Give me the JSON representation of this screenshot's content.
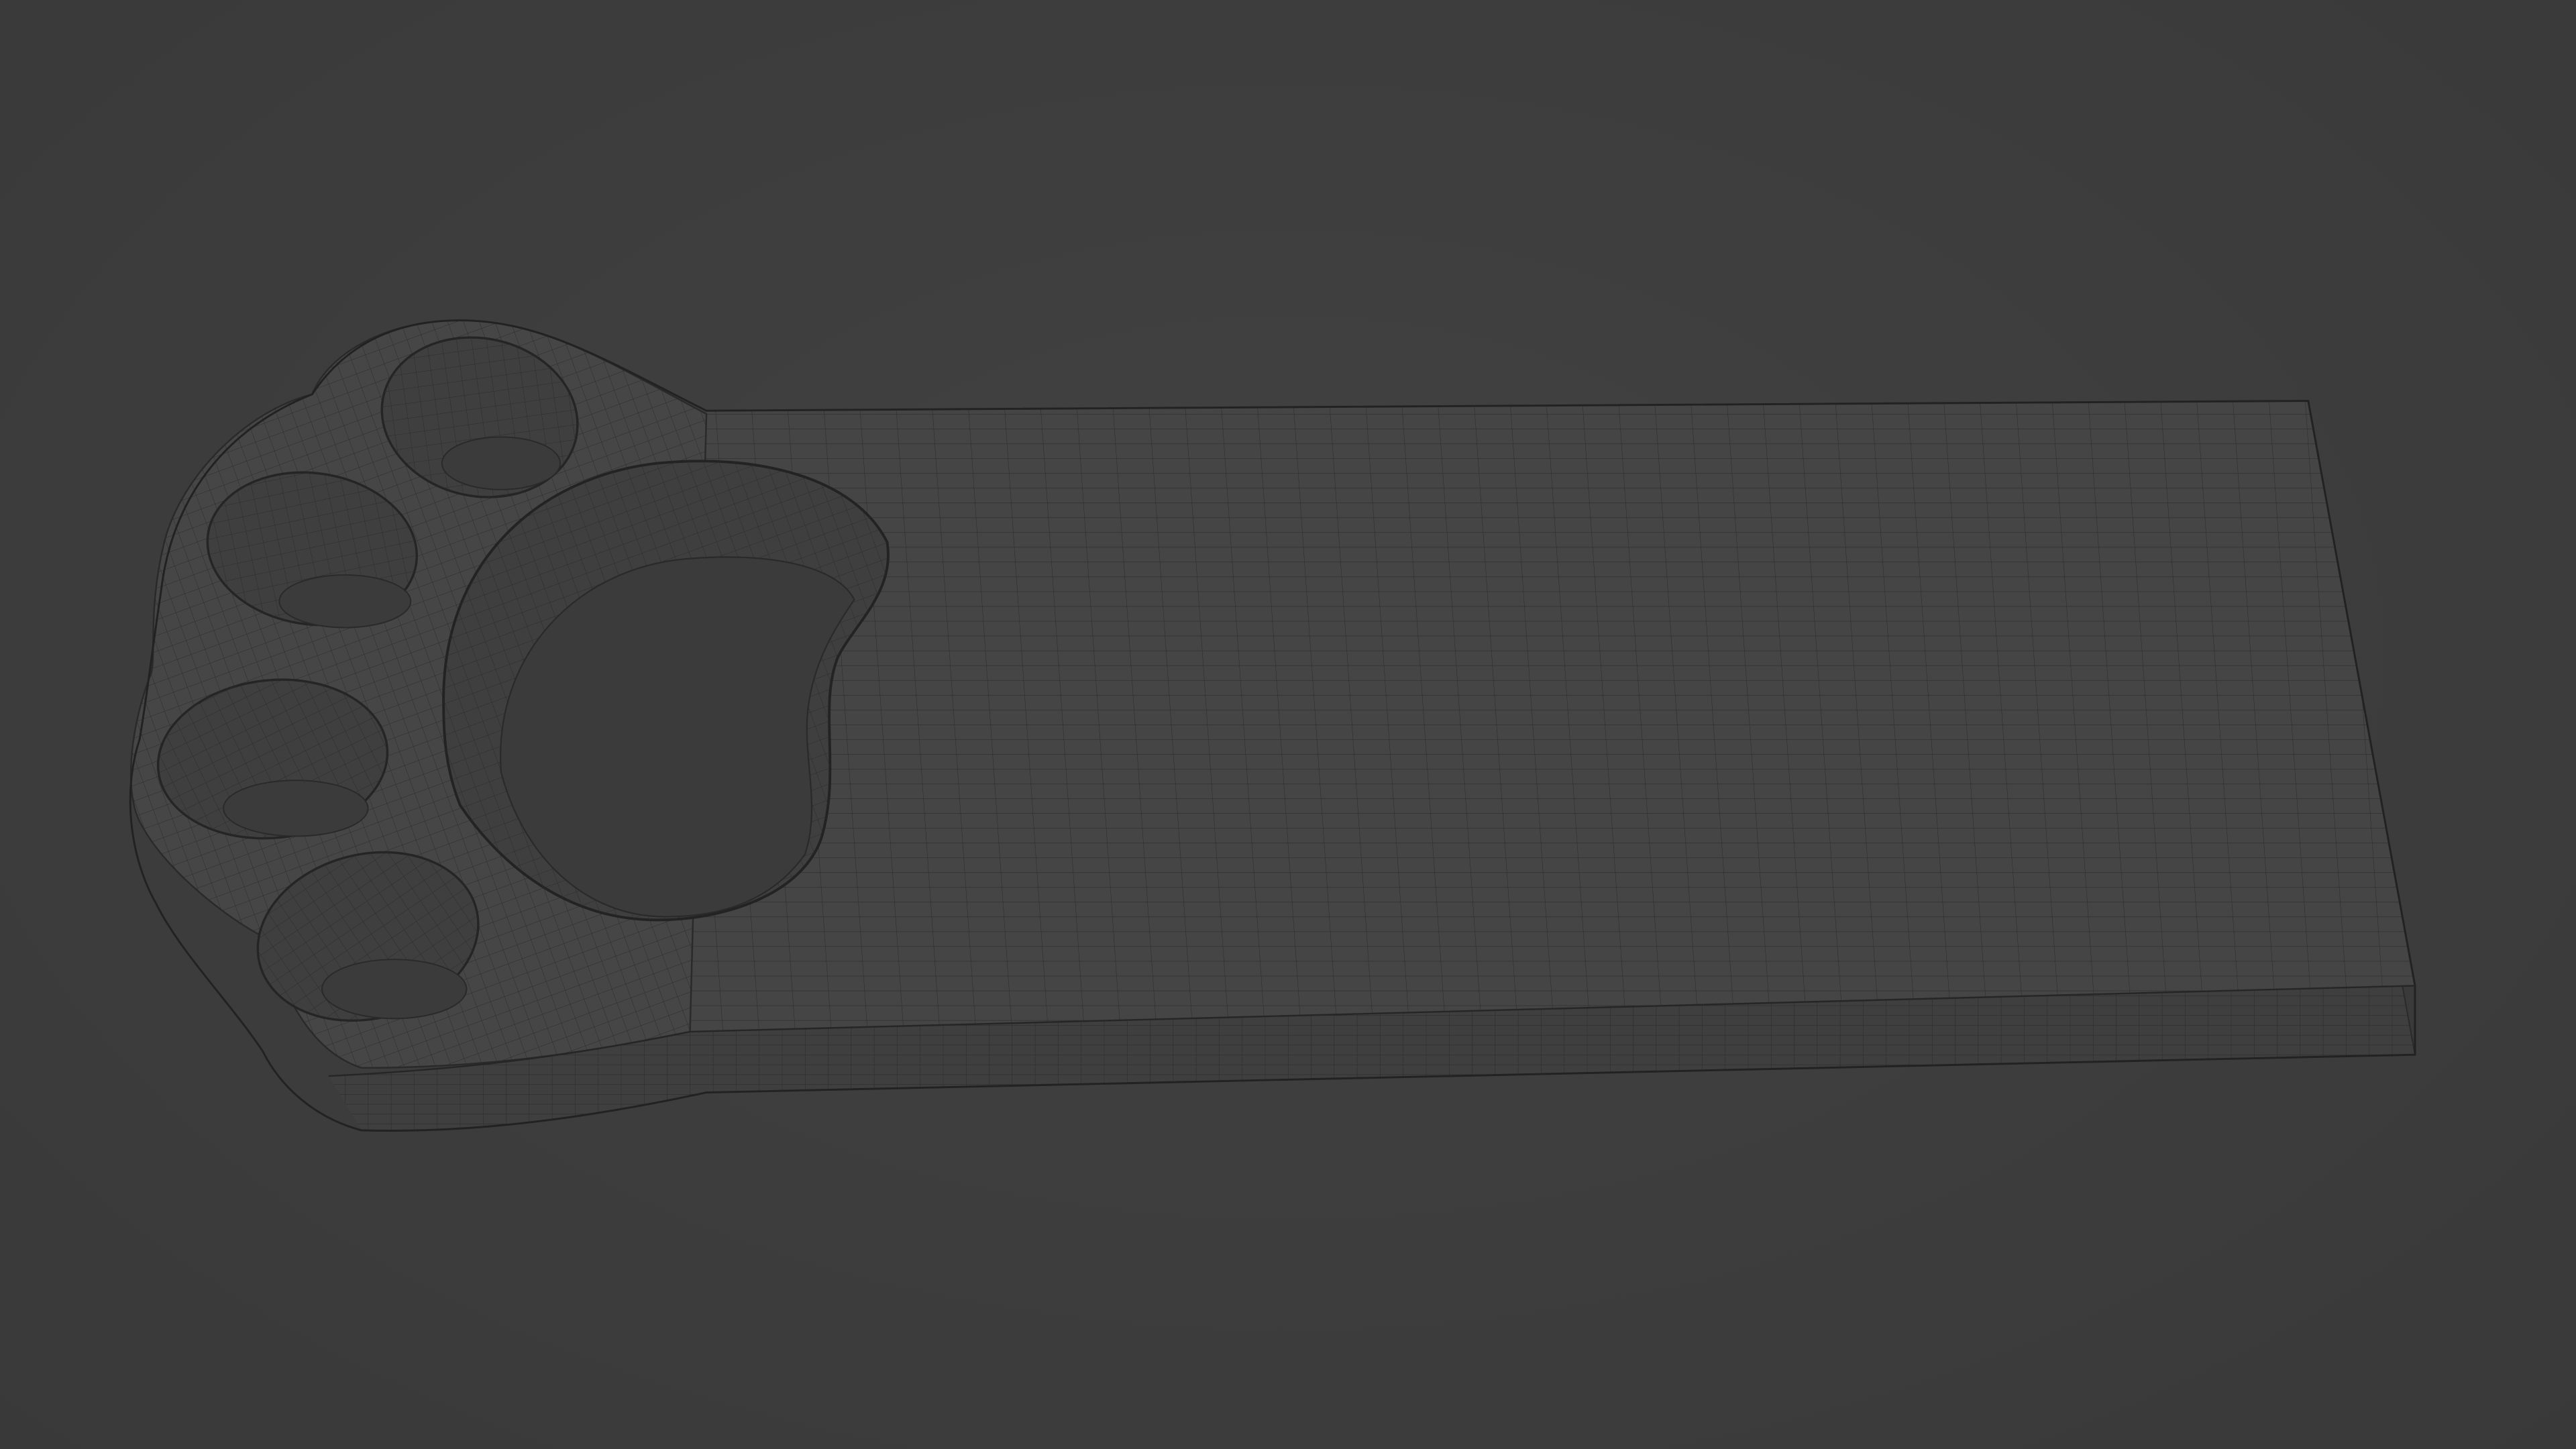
{
  "viewport": {
    "background_color": "#3d3d3d",
    "shading": "solid-gray"
  },
  "object": {
    "kind": "mesh",
    "shape": "paw-bar",
    "display": "wireframe-overlay",
    "surface_color": "#454545",
    "side_color": "#3f3f3f",
    "wire_color": "#2a2a2a",
    "hole_color": "#3b3b3b",
    "toe_hole_count": 4,
    "pad_hole_count": 1
  }
}
